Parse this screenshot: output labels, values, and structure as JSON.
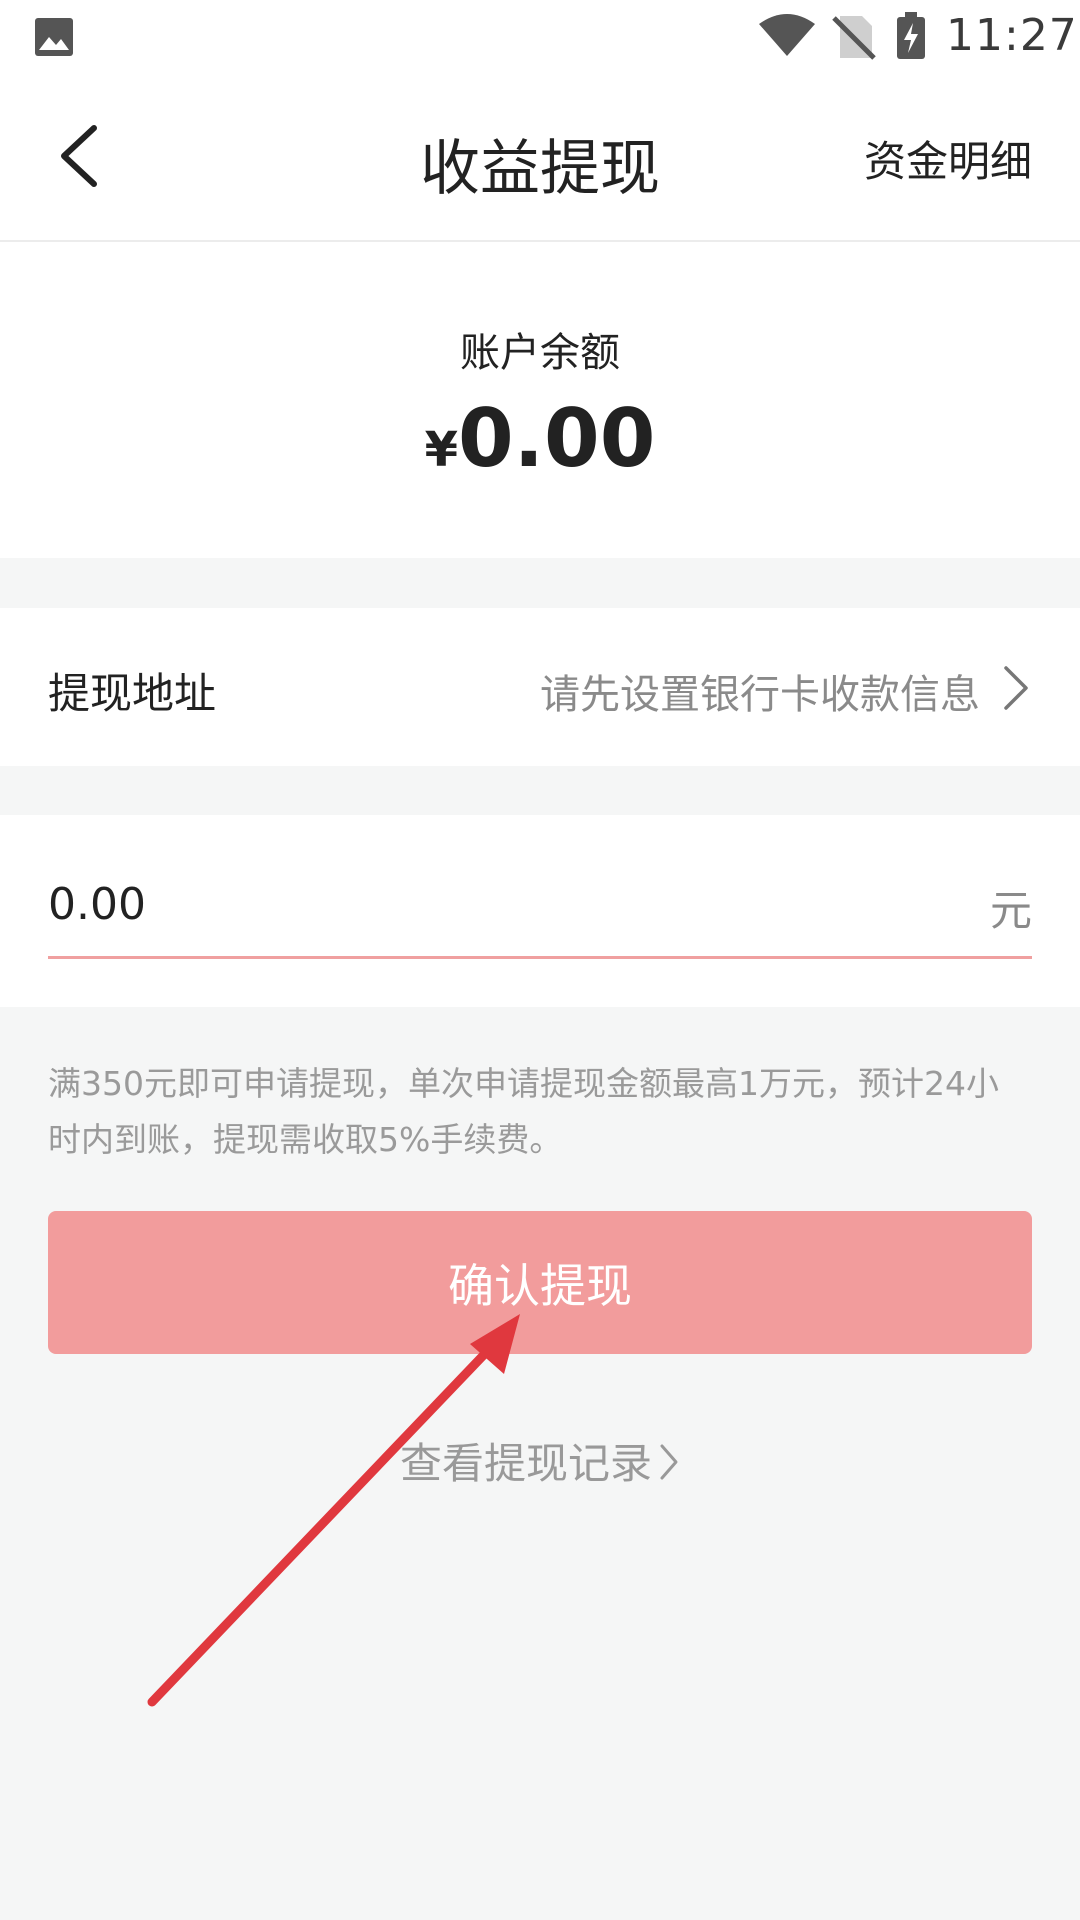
{
  "status_bar": {
    "time": "11:27",
    "icons": [
      "gallery-icon",
      "wifi-icon",
      "no-sim-icon",
      "battery-charging-icon"
    ]
  },
  "header": {
    "title": "收益提现",
    "right_action": "资金明细",
    "back_icon": "chevron-left-icon"
  },
  "balance": {
    "label": "账户余额",
    "currency": "¥",
    "amount": "0.00"
  },
  "withdraw_address": {
    "label": "提现地址",
    "value": "请先设置银行卡收款信息",
    "icon": "chevron-right-icon"
  },
  "amount_input": {
    "value": "0.00",
    "unit": "元",
    "underline_color": "#f0a0a0"
  },
  "notice": "满350元即可申请提现，单次申请提现金额最高1万元，预计24小时内到账，提现需收取5%手续费。",
  "confirm_button": {
    "label": "确认提现",
    "color": "#f29c9c"
  },
  "records_link": {
    "label": "查看提现记录",
    "icon": "chevron-right-icon"
  },
  "annotation": {
    "icon": "arrow-icon",
    "color": "#e0383e"
  }
}
